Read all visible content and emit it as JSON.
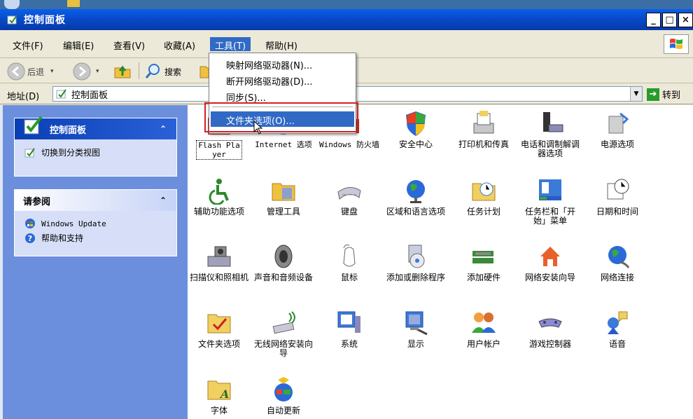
{
  "window": {
    "title": "控制面板",
    "controls": {
      "minimize": "_",
      "restore": "□",
      "close": "×"
    }
  },
  "menubar": {
    "items": [
      {
        "label": "文件(F)"
      },
      {
        "label": "编辑(E)"
      },
      {
        "label": "查看(V)"
      },
      {
        "label": "收藏(A)"
      },
      {
        "label": "工具(T)",
        "active": true
      },
      {
        "label": "帮助(H)"
      }
    ]
  },
  "toolbar": {
    "back_label": "后退",
    "search_label": "搜索"
  },
  "address": {
    "label": "地址(D)",
    "value": "控制面板",
    "go_label": "转到"
  },
  "tools_menu": {
    "items": [
      {
        "label": "映射网络驱动器(N)..."
      },
      {
        "label": "断开网络驱动器(D)..."
      },
      {
        "label": "同步(S)..."
      },
      {
        "label": "文件夹选项(O)...",
        "highlighted": true
      }
    ]
  },
  "left_pane": {
    "control_panel": {
      "title": "控制面板",
      "link": "切换到分类视图"
    },
    "see_also": {
      "title": "请参阅",
      "links": [
        "Windows Update",
        "帮助和支持"
      ]
    }
  },
  "items": [
    {
      "label": "Flash Player",
      "icon": "flash-player-icon"
    },
    {
      "label": "Internet 选项",
      "icon": "internet-options-icon"
    },
    {
      "label": "Windows 防火墙",
      "icon": "firewall-icon"
    },
    {
      "label": "安全中心",
      "icon": "security-center-icon"
    },
    {
      "label": "打印机和传真",
      "icon": "printers-icon"
    },
    {
      "label": "电话和调制解调器选项",
      "icon": "phone-modem-icon"
    },
    {
      "label": "电源选项",
      "icon": "power-options-icon"
    },
    {
      "label": "辅助功能选项",
      "icon": "accessibility-icon"
    },
    {
      "label": "管理工具",
      "icon": "admin-tools-icon"
    },
    {
      "label": "键盘",
      "icon": "keyboard-icon"
    },
    {
      "label": "区域和语言选项",
      "icon": "region-language-icon"
    },
    {
      "label": "任务计划",
      "icon": "scheduled-tasks-icon"
    },
    {
      "label": "任务栏和「开始」菜单",
      "icon": "taskbar-icon"
    },
    {
      "label": "日期和时间",
      "icon": "date-time-icon"
    },
    {
      "label": "扫描仪和照相机",
      "icon": "scanner-camera-icon"
    },
    {
      "label": "声音和音频设备",
      "icon": "sound-icon"
    },
    {
      "label": "鼠标",
      "icon": "mouse-icon"
    },
    {
      "label": "添加或删除程序",
      "icon": "add-remove-programs-icon"
    },
    {
      "label": "添加硬件",
      "icon": "add-hardware-icon"
    },
    {
      "label": "网络安装向导",
      "icon": "network-setup-icon"
    },
    {
      "label": "网络连接",
      "icon": "network-connections-icon"
    },
    {
      "label": "文件夹选项",
      "icon": "folder-options-icon"
    },
    {
      "label": "无线网络安装向导",
      "icon": "wireless-setup-icon"
    },
    {
      "label": "系统",
      "icon": "system-icon"
    },
    {
      "label": "显示",
      "icon": "display-icon"
    },
    {
      "label": "用户帐户",
      "icon": "user-accounts-icon"
    },
    {
      "label": "游戏控制器",
      "icon": "game-controllers-icon"
    },
    {
      "label": "语音",
      "icon": "speech-icon"
    },
    {
      "label": "字体",
      "icon": "fonts-icon"
    },
    {
      "label": "自动更新",
      "icon": "auto-update-icon"
    }
  ]
}
